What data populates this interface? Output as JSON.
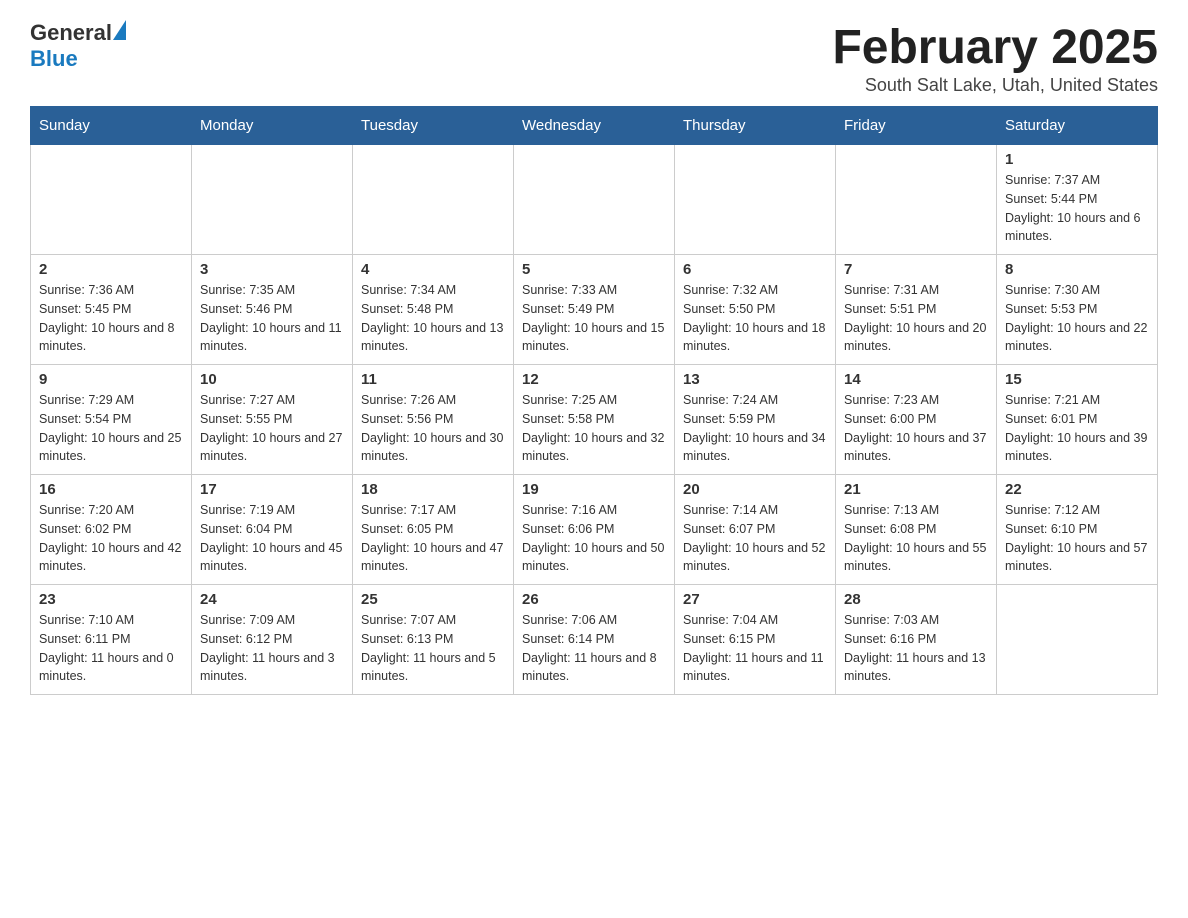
{
  "header": {
    "logo_general": "General",
    "logo_blue": "Blue",
    "month_title": "February 2025",
    "location": "South Salt Lake, Utah, United States"
  },
  "weekdays": [
    "Sunday",
    "Monday",
    "Tuesday",
    "Wednesday",
    "Thursday",
    "Friday",
    "Saturday"
  ],
  "weeks": [
    [
      {
        "day": "",
        "sunrise": "",
        "sunset": "",
        "daylight": ""
      },
      {
        "day": "",
        "sunrise": "",
        "sunset": "",
        "daylight": ""
      },
      {
        "day": "",
        "sunrise": "",
        "sunset": "",
        "daylight": ""
      },
      {
        "day": "",
        "sunrise": "",
        "sunset": "",
        "daylight": ""
      },
      {
        "day": "",
        "sunrise": "",
        "sunset": "",
        "daylight": ""
      },
      {
        "day": "",
        "sunrise": "",
        "sunset": "",
        "daylight": ""
      },
      {
        "day": "1",
        "sunrise": "Sunrise: 7:37 AM",
        "sunset": "Sunset: 5:44 PM",
        "daylight": "Daylight: 10 hours and 6 minutes."
      }
    ],
    [
      {
        "day": "2",
        "sunrise": "Sunrise: 7:36 AM",
        "sunset": "Sunset: 5:45 PM",
        "daylight": "Daylight: 10 hours and 8 minutes."
      },
      {
        "day": "3",
        "sunrise": "Sunrise: 7:35 AM",
        "sunset": "Sunset: 5:46 PM",
        "daylight": "Daylight: 10 hours and 11 minutes."
      },
      {
        "day": "4",
        "sunrise": "Sunrise: 7:34 AM",
        "sunset": "Sunset: 5:48 PM",
        "daylight": "Daylight: 10 hours and 13 minutes."
      },
      {
        "day": "5",
        "sunrise": "Sunrise: 7:33 AM",
        "sunset": "Sunset: 5:49 PM",
        "daylight": "Daylight: 10 hours and 15 minutes."
      },
      {
        "day": "6",
        "sunrise": "Sunrise: 7:32 AM",
        "sunset": "Sunset: 5:50 PM",
        "daylight": "Daylight: 10 hours and 18 minutes."
      },
      {
        "day": "7",
        "sunrise": "Sunrise: 7:31 AM",
        "sunset": "Sunset: 5:51 PM",
        "daylight": "Daylight: 10 hours and 20 minutes."
      },
      {
        "day": "8",
        "sunrise": "Sunrise: 7:30 AM",
        "sunset": "Sunset: 5:53 PM",
        "daylight": "Daylight: 10 hours and 22 minutes."
      }
    ],
    [
      {
        "day": "9",
        "sunrise": "Sunrise: 7:29 AM",
        "sunset": "Sunset: 5:54 PM",
        "daylight": "Daylight: 10 hours and 25 minutes."
      },
      {
        "day": "10",
        "sunrise": "Sunrise: 7:27 AM",
        "sunset": "Sunset: 5:55 PM",
        "daylight": "Daylight: 10 hours and 27 minutes."
      },
      {
        "day": "11",
        "sunrise": "Sunrise: 7:26 AM",
        "sunset": "Sunset: 5:56 PM",
        "daylight": "Daylight: 10 hours and 30 minutes."
      },
      {
        "day": "12",
        "sunrise": "Sunrise: 7:25 AM",
        "sunset": "Sunset: 5:58 PM",
        "daylight": "Daylight: 10 hours and 32 minutes."
      },
      {
        "day": "13",
        "sunrise": "Sunrise: 7:24 AM",
        "sunset": "Sunset: 5:59 PM",
        "daylight": "Daylight: 10 hours and 34 minutes."
      },
      {
        "day": "14",
        "sunrise": "Sunrise: 7:23 AM",
        "sunset": "Sunset: 6:00 PM",
        "daylight": "Daylight: 10 hours and 37 minutes."
      },
      {
        "day": "15",
        "sunrise": "Sunrise: 7:21 AM",
        "sunset": "Sunset: 6:01 PM",
        "daylight": "Daylight: 10 hours and 39 minutes."
      }
    ],
    [
      {
        "day": "16",
        "sunrise": "Sunrise: 7:20 AM",
        "sunset": "Sunset: 6:02 PM",
        "daylight": "Daylight: 10 hours and 42 minutes."
      },
      {
        "day": "17",
        "sunrise": "Sunrise: 7:19 AM",
        "sunset": "Sunset: 6:04 PM",
        "daylight": "Daylight: 10 hours and 45 minutes."
      },
      {
        "day": "18",
        "sunrise": "Sunrise: 7:17 AM",
        "sunset": "Sunset: 6:05 PM",
        "daylight": "Daylight: 10 hours and 47 minutes."
      },
      {
        "day": "19",
        "sunrise": "Sunrise: 7:16 AM",
        "sunset": "Sunset: 6:06 PM",
        "daylight": "Daylight: 10 hours and 50 minutes."
      },
      {
        "day": "20",
        "sunrise": "Sunrise: 7:14 AM",
        "sunset": "Sunset: 6:07 PM",
        "daylight": "Daylight: 10 hours and 52 minutes."
      },
      {
        "day": "21",
        "sunrise": "Sunrise: 7:13 AM",
        "sunset": "Sunset: 6:08 PM",
        "daylight": "Daylight: 10 hours and 55 minutes."
      },
      {
        "day": "22",
        "sunrise": "Sunrise: 7:12 AM",
        "sunset": "Sunset: 6:10 PM",
        "daylight": "Daylight: 10 hours and 57 minutes."
      }
    ],
    [
      {
        "day": "23",
        "sunrise": "Sunrise: 7:10 AM",
        "sunset": "Sunset: 6:11 PM",
        "daylight": "Daylight: 11 hours and 0 minutes."
      },
      {
        "day": "24",
        "sunrise": "Sunrise: 7:09 AM",
        "sunset": "Sunset: 6:12 PM",
        "daylight": "Daylight: 11 hours and 3 minutes."
      },
      {
        "day": "25",
        "sunrise": "Sunrise: 7:07 AM",
        "sunset": "Sunset: 6:13 PM",
        "daylight": "Daylight: 11 hours and 5 minutes."
      },
      {
        "day": "26",
        "sunrise": "Sunrise: 7:06 AM",
        "sunset": "Sunset: 6:14 PM",
        "daylight": "Daylight: 11 hours and 8 minutes."
      },
      {
        "day": "27",
        "sunrise": "Sunrise: 7:04 AM",
        "sunset": "Sunset: 6:15 PM",
        "daylight": "Daylight: 11 hours and 11 minutes."
      },
      {
        "day": "28",
        "sunrise": "Sunrise: 7:03 AM",
        "sunset": "Sunset: 6:16 PM",
        "daylight": "Daylight: 11 hours and 13 minutes."
      },
      {
        "day": "",
        "sunrise": "",
        "sunset": "",
        "daylight": ""
      }
    ]
  ]
}
